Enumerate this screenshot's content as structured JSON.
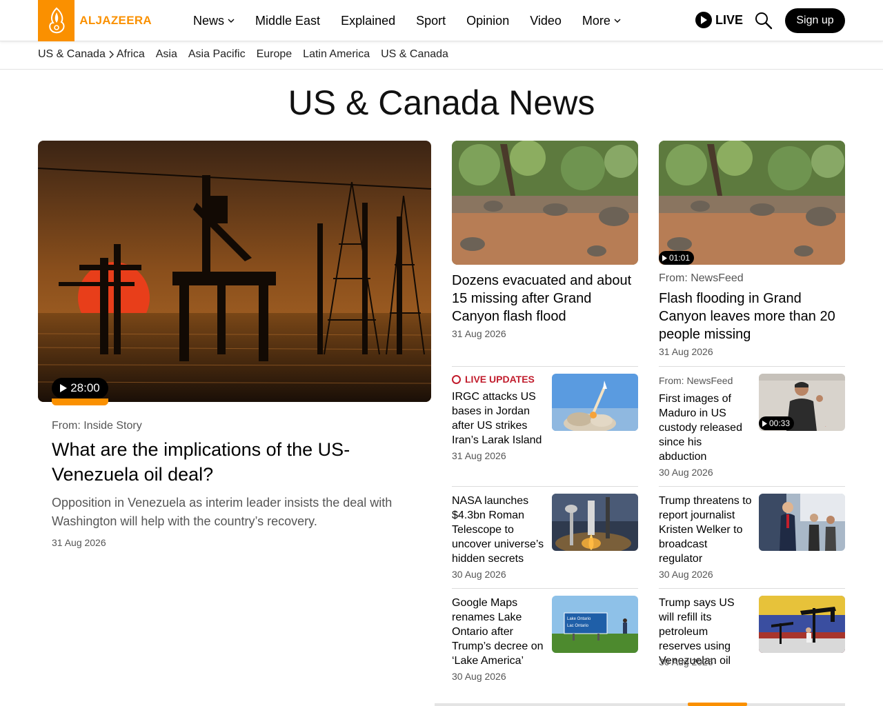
{
  "brand": {
    "name": "ALJAZEERA",
    "color": "#fa9000"
  },
  "nav": {
    "items": [
      {
        "label": "News",
        "dropdown": true
      },
      {
        "label": "Middle East",
        "dropdown": false
      },
      {
        "label": "Explained",
        "dropdown": false
      },
      {
        "label": "Sport",
        "dropdown": false
      },
      {
        "label": "Opinion",
        "dropdown": false
      },
      {
        "label": "Video",
        "dropdown": false
      },
      {
        "label": "More",
        "dropdown": true
      }
    ],
    "live_label": "LIVE",
    "signup_label": "Sign up"
  },
  "subnav": {
    "current": "US & Canada",
    "items": [
      "Africa",
      "Asia",
      "Asia Pacific",
      "Europe",
      "Latin America",
      "US & Canada"
    ]
  },
  "page": {
    "title": "US & Canada News"
  },
  "feature": {
    "duration": "28:00",
    "from": "From: Inside Story",
    "title": "What are the implications of the US-Venezuela oil deal?",
    "excerpt": "Opposition in Venezuela as interim leader insists the deal with Washington will help with the country’s recovery.",
    "date": "31 Aug 2026"
  },
  "column_cards": [
    {
      "title": "Dozens evacuated and about 15 missing after Grand Canyon flash flood",
      "date": "31 Aug 2026",
      "from": "",
      "duration": ""
    },
    {
      "title": "Flash flooding in Grand Canyon leaves more than 20 people missing",
      "date": "31 Aug 2026",
      "from": "From: NewsFeed",
      "duration": "01:01"
    }
  ],
  "list_left": [
    {
      "tag": "LIVE UPDATES",
      "title": "IRGC attacks US bases in Jordan after US strikes Iran’s Larak Island",
      "date": "31 Aug 2026"
    },
    {
      "tag": "",
      "title": "NASA launches $4.3bn Roman Telescope to uncover universe’s hidden secrets",
      "date": "30 Aug 2026"
    },
    {
      "tag": "",
      "title": "Google Maps renames Lake Ontario after Trump’s decree on ‘Lake America’",
      "date": "30 Aug 2026"
    }
  ],
  "list_right": [
    {
      "from": "From: NewsFeed",
      "title": "First images of Maduro in US custody released since his abduction",
      "date": "30 Aug 2026",
      "duration": "00:33"
    },
    {
      "from": "",
      "title": "Trump threatens to report journalist Kristen Welker to broadcast regulator",
      "date": "30 Aug 2026",
      "duration": ""
    },
    {
      "from": "",
      "title": "Trump says US will refill its petroleum reserves using Venezuelan oil",
      "date": "30 Aug 2026",
      "duration": ""
    }
  ],
  "sign_text": {
    "line1": "Lake Ontario",
    "line2": "Lac Ontario"
  }
}
